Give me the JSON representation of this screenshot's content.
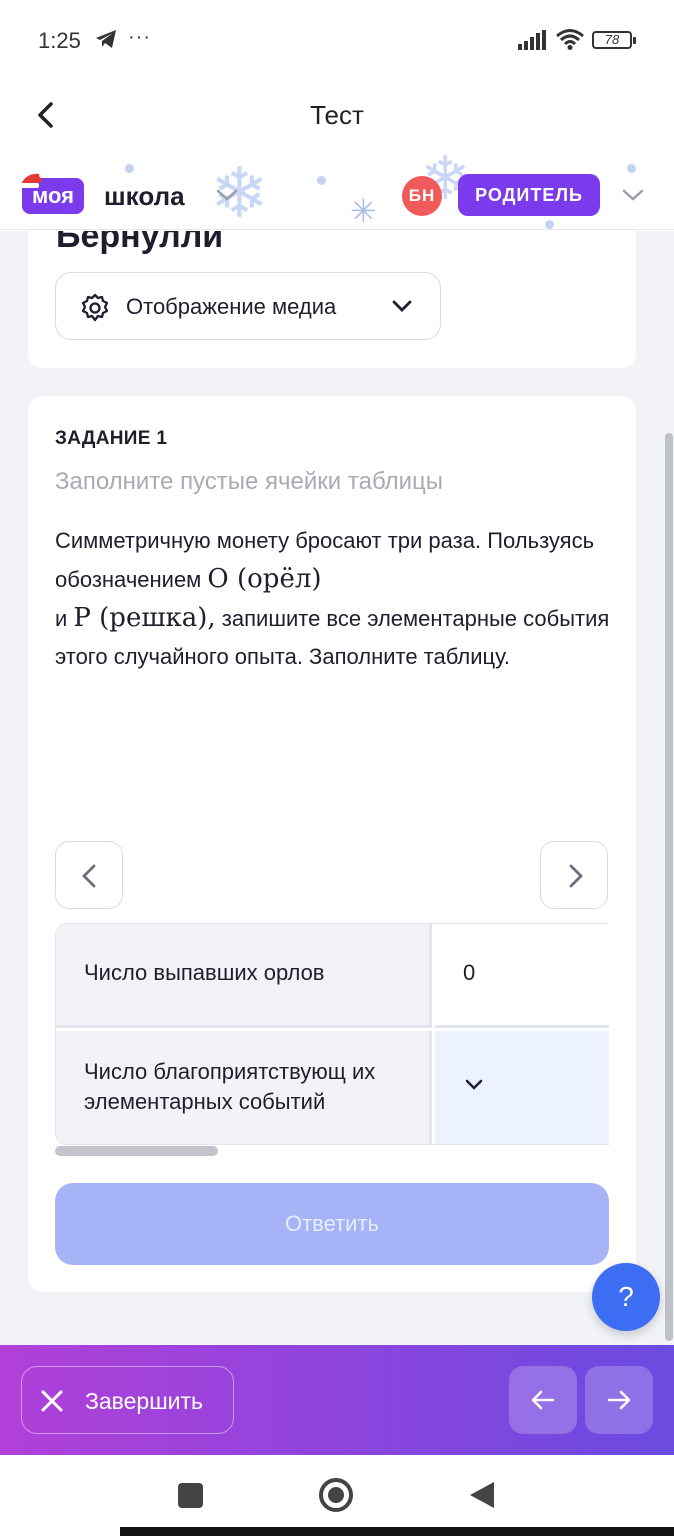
{
  "status_bar": {
    "time": "1:25",
    "more": "···",
    "battery": "78"
  },
  "top_nav": {
    "title": "Тест"
  },
  "header": {
    "logo_badge": "моя",
    "logo_text": "школа",
    "avatar_initials": "БН",
    "role": "РОДИТЕЛЬ",
    "accent_color": "#7c3aed",
    "avatar_color": "#f05a5a"
  },
  "test": {
    "name_partial": "Бернулли",
    "media_button_label": "Отображение медиа"
  },
  "task": {
    "number": "ЗАДАНИЕ 1",
    "instruction": "Заполните пустые ячейки таблицы",
    "text_part1": "Симметричную монету бросают три раза. Пользуясь обозначением ",
    "math_o": "O (орёл)",
    "text_part2": "и ",
    "math_p": "P (решка),",
    "text_part3": " запишите все элементарные события этого случайного опыта. Заполните таблицу.",
    "table": {
      "row1_header": "Число выпавших орлов",
      "row1_value": "0",
      "row2_header": "Число благоприятствующ их элементарных событий"
    },
    "answer_button": "Ответить"
  },
  "help_button": "?",
  "bottom_bar": {
    "finish_label": "Завершить"
  },
  "icons": [
    "telegram-icon",
    "signal-icon",
    "wifi-icon",
    "back-icon",
    "chevron-down-icon",
    "gear-icon",
    "chevron-left-icon",
    "chevron-right-icon",
    "close-icon",
    "arrow-left-icon",
    "arrow-right-icon"
  ]
}
